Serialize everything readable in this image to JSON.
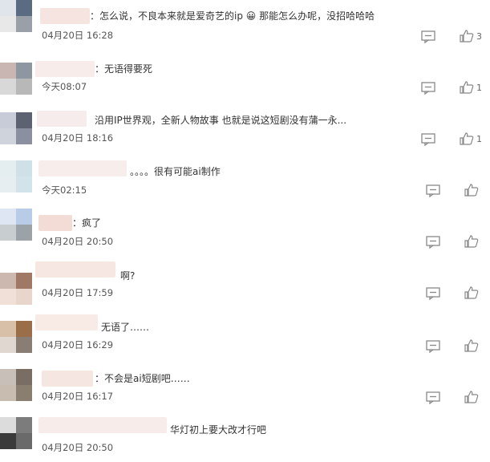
{
  "comments": [
    {
      "text": "：怎么说，不良本来就是爱奇艺的ip 😀 那能怎么办呢，没招哈哈哈",
      "time": "04月20日 16:28",
      "likes": "3"
    },
    {
      "text": "：无语得要死",
      "time": "今天08:07",
      "likes": "1"
    },
    {
      "text": "沿用IP世界观，全新人物故事 也就是说这短剧没有蒲一永...",
      "time": "04月20日 18:16",
      "likes": "1"
    },
    {
      "text": "。。。。很有可能ai制作",
      "time": "今天02:15",
      "likes": ""
    },
    {
      "text": "：疯了",
      "time": "04月20日 20:50",
      "likes": ""
    },
    {
      "text": "啊?",
      "time": "04月20日 17:59",
      "likes": ""
    },
    {
      "text": "无语了……",
      "time": "04月20日 16:29",
      "likes": ""
    },
    {
      "text": "：不会是ai短剧吧……",
      "time": "04月20日 16:17",
      "likes": ""
    },
    {
      "text": "华灯初上要大改才行吧",
      "time": "04月20日 20:50",
      "likes": ""
    }
  ],
  "colors": {
    "text": "#333333",
    "time": "#555555",
    "icon": "#888888"
  }
}
